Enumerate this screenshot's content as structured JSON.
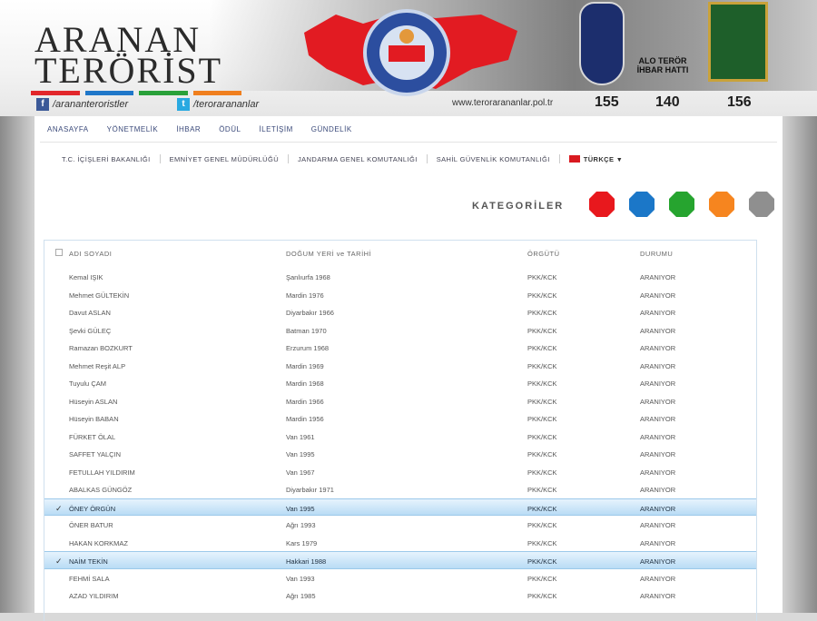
{
  "header": {
    "logo_line1": "ARANAN",
    "logo_line2": "TERÖRİST",
    "facebook_handle": "/arananteroristler",
    "twitter_handle": "/terorarananlar",
    "website": "www.terorarananlar.pol.tr",
    "hotline_label": "ALO TERÖR İHBAR HATTI",
    "phones": [
      "155",
      "140",
      "156"
    ],
    "bar_colors": [
      "#e2262b",
      "#1f77c9",
      "#2aa13a",
      "#f07f1e"
    ]
  },
  "nav": {
    "main": [
      "ANASAYFA",
      "YÖNETMELİK",
      "İHBAR",
      "ÖDÜL",
      "İLETİŞİM",
      "GÜNDELİK"
    ],
    "sub": [
      "T.C. İÇİŞLERİ BAKANLIĞI",
      "EMNİYET GENEL MÜDÜRLÜĞÜ",
      "JANDARMA GENEL KOMUTANLIĞI",
      "SAHİL GÜVENLİK KOMUTANLIĞI"
    ],
    "language": "TÜRKÇE"
  },
  "categories": {
    "label": "KATEGORİLER",
    "colors": [
      "#e8181d",
      "#1b77c8",
      "#26a42f",
      "#f6851f",
      "#8f8f8f"
    ]
  },
  "table": {
    "headers": [
      "ADI SOYADI",
      "DOĞUM YERİ ve TARİHİ",
      "ÖRGÜTÜ",
      "DURUMU"
    ],
    "rows": [
      {
        "name": "Kemal IŞIK",
        "birth": "Şanlıurfa 1968",
        "org": "PKK/KCK",
        "status": "ARANIYOR",
        "selected": false
      },
      {
        "name": "Mehmet GÜLTEKİN",
        "birth": "Mardin 1976",
        "org": "PKK/KCK",
        "status": "ARANIYOR",
        "selected": false
      },
      {
        "name": "Davut ASLAN",
        "birth": "Diyarbakır 1966",
        "org": "PKK/KCK",
        "status": "ARANIYOR",
        "selected": false
      },
      {
        "name": "Şevki GÜLEÇ",
        "birth": "Batman 1970",
        "org": "PKK/KCK",
        "status": "ARANIYOR",
        "selected": false
      },
      {
        "name": "Ramazan BOZKURT",
        "birth": "Erzurum 1968",
        "org": "PKK/KCK",
        "status": "ARANIYOR",
        "selected": false
      },
      {
        "name": "Mehmet Reşit ALP",
        "birth": "Mardin 1969",
        "org": "PKK/KCK",
        "status": "ARANIYOR",
        "selected": false
      },
      {
        "name": "Tuyulu ÇAM",
        "birth": "Mardin 1968",
        "org": "PKK/KCK",
        "status": "ARANIYOR",
        "selected": false
      },
      {
        "name": "Hüseyin ASLAN",
        "birth": "Mardin 1966",
        "org": "PKK/KCK",
        "status": "ARANIYOR",
        "selected": false
      },
      {
        "name": "Hüseyin BABAN",
        "birth": "Mardin 1956",
        "org": "PKK/KCK",
        "status": "ARANIYOR",
        "selected": false
      },
      {
        "name": "FÜRKET ÖLAL",
        "birth": "Van 1961",
        "org": "PKK/KCK",
        "status": "ARANIYOR",
        "selected": false
      },
      {
        "name": "SAFFET YALÇIN",
        "birth": "Van 1995",
        "org": "PKK/KCK",
        "status": "ARANIYOR",
        "selected": false
      },
      {
        "name": "FETULLAH YILDIRIM",
        "birth": "Van 1967",
        "org": "PKK/KCK",
        "status": "ARANIYOR",
        "selected": false
      },
      {
        "name": "ABALKAS GÜNGÖZ",
        "birth": "Diyarbakır 1971",
        "org": "PKK/KCK",
        "status": "ARANIYOR",
        "selected": false
      },
      {
        "name": "ÖNEY ÖRGÜN",
        "birth": "Van 1995",
        "org": "PKK/KCK",
        "status": "ARANIYOR",
        "selected": true
      },
      {
        "name": "ÖNER BATUR",
        "birth": "Ağrı 1993",
        "org": "PKK/KCK",
        "status": "ARANIYOR",
        "selected": false
      },
      {
        "name": "HAKAN KORKMAZ",
        "birth": "Kars 1979",
        "org": "PKK/KCK",
        "status": "ARANIYOR",
        "selected": false
      },
      {
        "name": "NAİM TEKİN",
        "birth": "Hakkari 1988",
        "org": "PKK/KCK",
        "status": "ARANIYOR",
        "selected": true
      },
      {
        "name": "FEHMİ SALA",
        "birth": "Van 1993",
        "org": "PKK/KCK",
        "status": "ARANIYOR",
        "selected": false
      },
      {
        "name": "AZAD YILDIRIM",
        "birth": "Ağrı 1985",
        "org": "PKK/KCK",
        "status": "ARANIYOR",
        "selected": false
      }
    ]
  }
}
